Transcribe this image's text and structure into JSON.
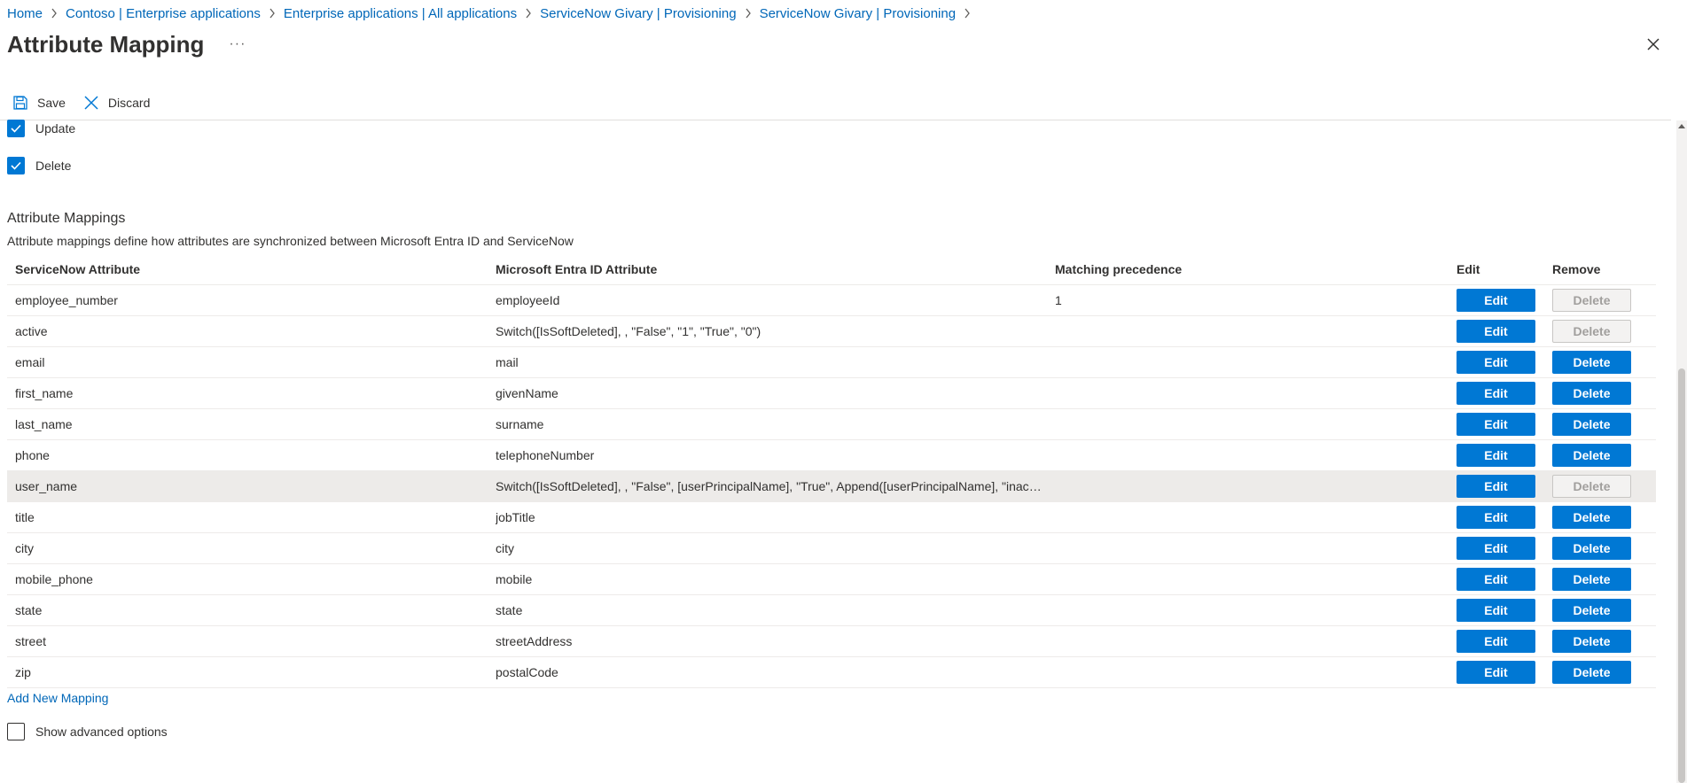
{
  "breadcrumb": [
    "Home",
    "Contoso | Enterprise applications",
    "Enterprise applications | All applications",
    "ServiceNow Givary | Provisioning",
    "ServiceNow Givary | Provisioning"
  ],
  "page_title": "Attribute Mapping",
  "more_label": "···",
  "toolbar": {
    "save_label": "Save",
    "discard_label": "Discard"
  },
  "target_actions": [
    {
      "label": "Update",
      "checked": true
    },
    {
      "label": "Delete",
      "checked": true
    }
  ],
  "mappings_section": {
    "title": "Attribute Mappings",
    "description": "Attribute mappings define how attributes are synchronized between Microsoft Entra ID and ServiceNow"
  },
  "table": {
    "columns": [
      "ServiceNow Attribute",
      "Microsoft Entra ID Attribute",
      "Matching precedence",
      "Edit",
      "Remove"
    ],
    "edit_label": "Edit",
    "delete_label": "Delete",
    "rows": [
      {
        "target": "employee_number",
        "source": "employeeId",
        "precedence": "1",
        "delete_enabled": false
      },
      {
        "target": "active",
        "source": "Switch([IsSoftDeleted], , \"False\", \"1\", \"True\", \"0\")",
        "precedence": "",
        "delete_enabled": false
      },
      {
        "target": "email",
        "source": "mail",
        "precedence": "",
        "delete_enabled": true
      },
      {
        "target": "first_name",
        "source": "givenName",
        "precedence": "",
        "delete_enabled": true
      },
      {
        "target": "last_name",
        "source": "surname",
        "precedence": "",
        "delete_enabled": true
      },
      {
        "target": "phone",
        "source": "telephoneNumber",
        "precedence": "",
        "delete_enabled": true
      },
      {
        "target": "user_name",
        "source": "Switch([IsSoftDeleted], , \"False\", [userPrincipalName], \"True\", Append([userPrincipalName], \"inacti...",
        "precedence": "",
        "delete_enabled": false,
        "highlighted": true
      },
      {
        "target": "title",
        "source": "jobTitle",
        "precedence": "",
        "delete_enabled": true
      },
      {
        "target": "city",
        "source": "city",
        "precedence": "",
        "delete_enabled": true
      },
      {
        "target": "mobile_phone",
        "source": "mobile",
        "precedence": "",
        "delete_enabled": true
      },
      {
        "target": "state",
        "source": "state",
        "precedence": "",
        "delete_enabled": true
      },
      {
        "target": "street",
        "source": "streetAddress",
        "precedence": "",
        "delete_enabled": true
      },
      {
        "target": "zip",
        "source": "postalCode",
        "precedence": "",
        "delete_enabled": true
      }
    ]
  },
  "add_mapping_label": "Add New Mapping",
  "advanced_options": {
    "label": "Show advanced options",
    "checked": false
  },
  "colors": {
    "accent": "#0078d4",
    "link": "#0067b8",
    "text": "#323130",
    "highlight_row": "#edebe9"
  }
}
